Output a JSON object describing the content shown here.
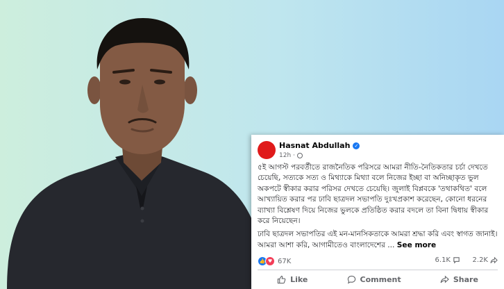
{
  "post": {
    "author": "Hasnat Abdullah",
    "time": "12h ·",
    "paragraph1": "৫ই আগস্ট পরবর্তীতে রাজনৈতিক পরিসরে আমরা নীতি-নৈতিকতার চর্চা দেখতে চেয়েছি, সত্যকে সত্য ও মিথ্যাকে মিথ্যা বলে নিজের ইচ্ছা বা অনিচ্ছাকৃত ভুল অকপটে স্বীকার করার পরিসর দেখতে চেয়েছি। জুলাই বিপ্লবকে 'তথাকথিত' বলে আখ্যায়িত করার পর ঢাবি ছাত্রদল সভাপতি দুঃখপ্রকাশ করেছেন, কোনো ধরনের ব্যাখ্যা বিশ্লেষণ দিয়ে নিজের ভুলকে প্রতিষ্ঠিত করার বদলে তা বিনা দ্বিধায় স্বীকার করে নিয়েছেন।",
    "paragraph2": "ঢাবি ছাত্রদল সভাপতির এই মন-মানসিকতাকে আমরা শ্রদ্ধা করি এবং স্বাগত জানাই। আমরা আশা করি, আগামীতেও বাংলাদেশের ...",
    "see_more": "See more",
    "reactions_count": "67K",
    "comments_count": "6.1K",
    "shares_count": "2.2K",
    "like_label": "Like",
    "comment_label": "Comment",
    "share_label": "Share"
  },
  "colors": {
    "brand_blue": "#1877f2",
    "avatar_red": "#e01b1b",
    "love_red": "#f33e58"
  },
  "icons": [
    "verified-badge-icon",
    "globe-icon",
    "like-reaction-icon",
    "love-reaction-icon",
    "comment-icon",
    "share-icon",
    "thumbs-up-icon"
  ]
}
